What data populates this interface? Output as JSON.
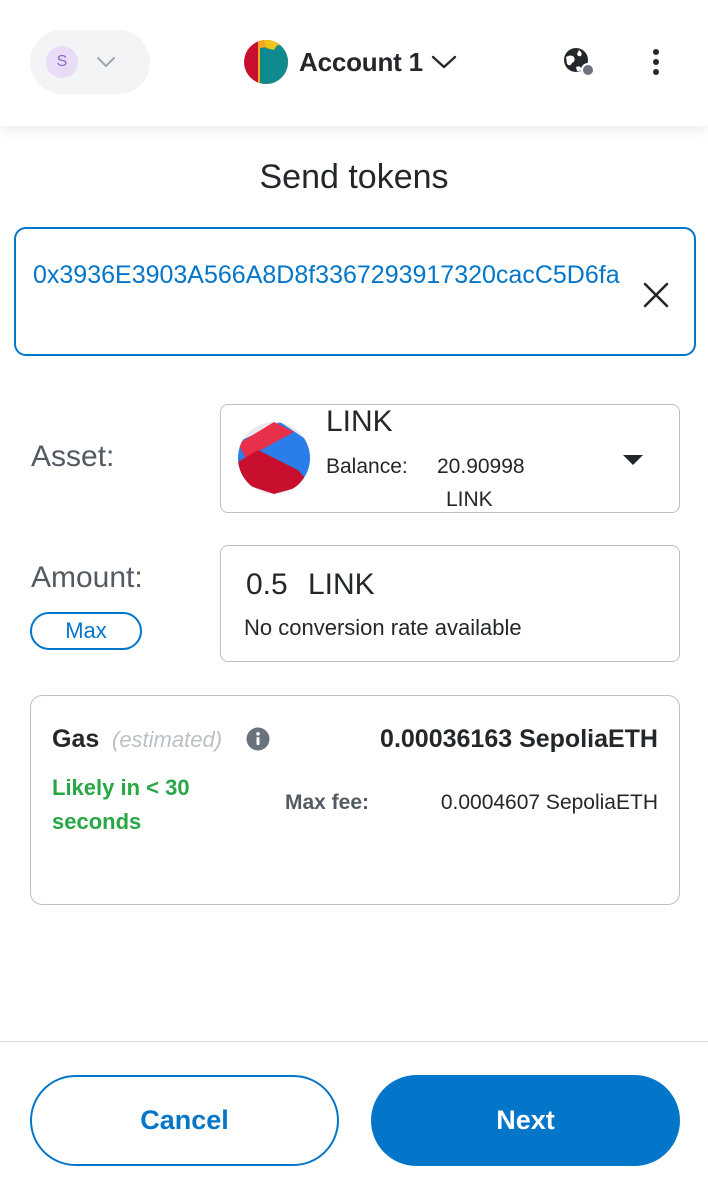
{
  "header": {
    "network_avatar_letter": "S",
    "account_name": "Account 1",
    "icons": {
      "network_dropdown": "chevron-down-icon",
      "account_dropdown": "chevron-down-icon",
      "connected_sites": "globe-icon",
      "menu": "kebab-menu-icon"
    }
  },
  "page_title": "Send tokens",
  "recipient": {
    "address": "0x3936E3903A566A8D8f3367293917320cacC5D6fa",
    "clear_icon": "close-icon"
  },
  "asset": {
    "label": "Asset:",
    "symbol": "LINK",
    "balance_label": "Balance:",
    "balance_value": "20.90998",
    "balance_unit": "LINK",
    "dropdown_icon": "caret-down-icon"
  },
  "amount": {
    "label": "Amount:",
    "max_label": "Max",
    "value": "0.5",
    "unit": "LINK",
    "conversion_note": "No conversion rate available"
  },
  "gas": {
    "title": "Gas",
    "subtitle": "(estimated)",
    "info_icon": "info-icon",
    "total": "0.00036163 SepoliaETH",
    "likely": "Likely in < 30 seconds",
    "max_fee_label": "Max fee:",
    "max_fee_value": "0.0004607 SepoliaETH"
  },
  "footer": {
    "cancel_label": "Cancel",
    "next_label": "Next"
  },
  "colors": {
    "primary": "#0376c9",
    "success": "#28a745",
    "border": "#bbc0c5",
    "text": "#24272a"
  }
}
